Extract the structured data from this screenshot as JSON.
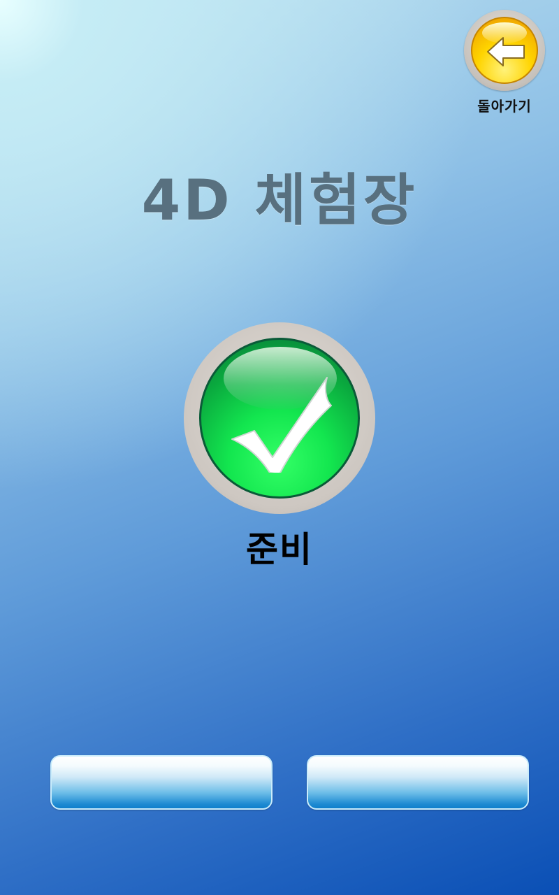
{
  "header": {
    "back_label": "돌아가기",
    "back_icon": "arrow-left-icon"
  },
  "main": {
    "title": "4D 체험장",
    "status": {
      "icon": "checkmark-icon",
      "label": "준비",
      "color": "#13e64f"
    }
  },
  "footer": {
    "buttons": [
      {
        "label": ""
      },
      {
        "label": ""
      }
    ]
  },
  "colors": {
    "title": "#58707f",
    "accent_yellow": "#ffd400",
    "button_blue": "#1d8ad2"
  }
}
